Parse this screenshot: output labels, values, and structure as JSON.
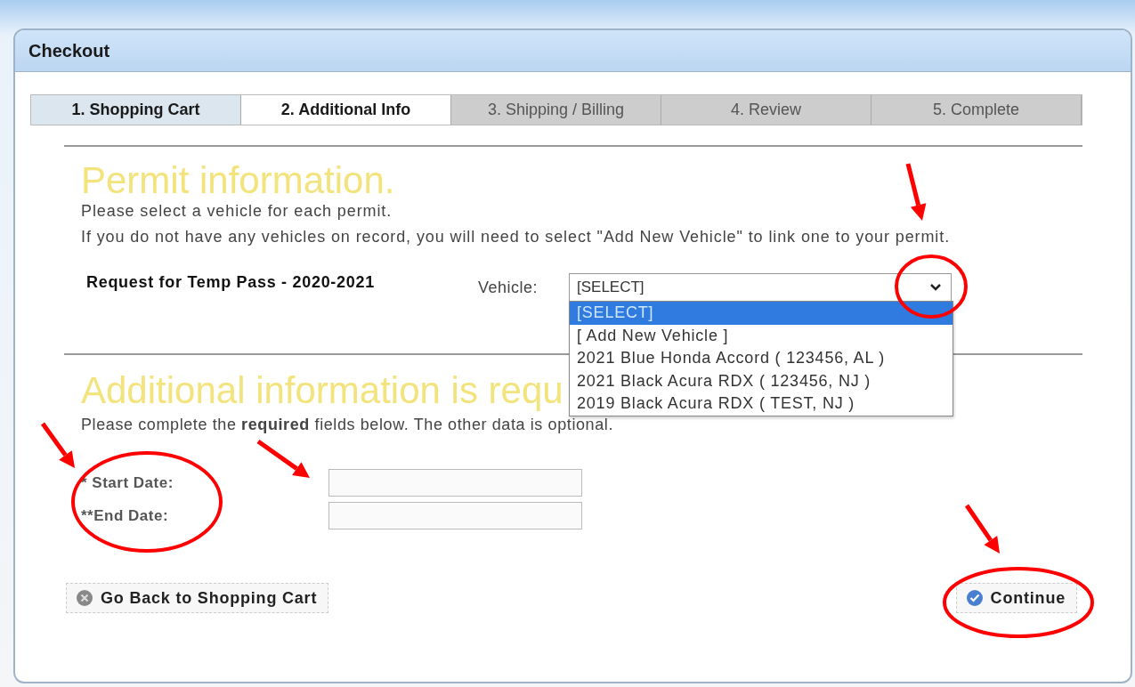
{
  "window": {
    "title": "Checkout"
  },
  "steps": [
    {
      "label": "1. Shopping Cart",
      "selected": false,
      "completed": true
    },
    {
      "label": "2. Additional Info",
      "selected": true,
      "completed": false
    },
    {
      "label": "3. Shipping / Billing",
      "selected": false,
      "completed": false
    },
    {
      "label": "4. Review",
      "selected": false,
      "completed": false
    },
    {
      "label": "5. Complete",
      "selected": false,
      "completed": false
    }
  ],
  "permit": {
    "heading": "Permit information.",
    "lines": [
      "Please select a vehicle for each permit.",
      "If you do not have any vehicles on record, you will need to select \"Add New Vehicle\" to link one to your permit."
    ],
    "request_label": "Request for Temp Pass - 2020-2021",
    "vehicle_label": "Vehicle:",
    "vehicle_value": "[SELECT]",
    "dropdown": {
      "expanded": true,
      "options": [
        {
          "label": "[SELECT]",
          "selected": true
        },
        {
          "label": "[ Add New Vehicle ]",
          "selected": false
        },
        {
          "label": "2021 Blue Honda Accord ( 123456, AL )",
          "selected": false
        },
        {
          "label": "2021 Black Acura RDX ( 123456, NJ )",
          "selected": false
        },
        {
          "label": "2019 Black Acura RDX ( TEST, NJ )",
          "selected": false
        }
      ]
    }
  },
  "additional": {
    "heading": "Additional information is requ",
    "note": "Please complete the **required** fields below. The other data is optional.",
    "fields": [
      {
        "label": "* Start Date:"
      },
      {
        "label": "**End Date:"
      }
    ]
  },
  "buttons": {
    "back": "Go Back to Shopping Cart",
    "continue": "Continue"
  }
}
